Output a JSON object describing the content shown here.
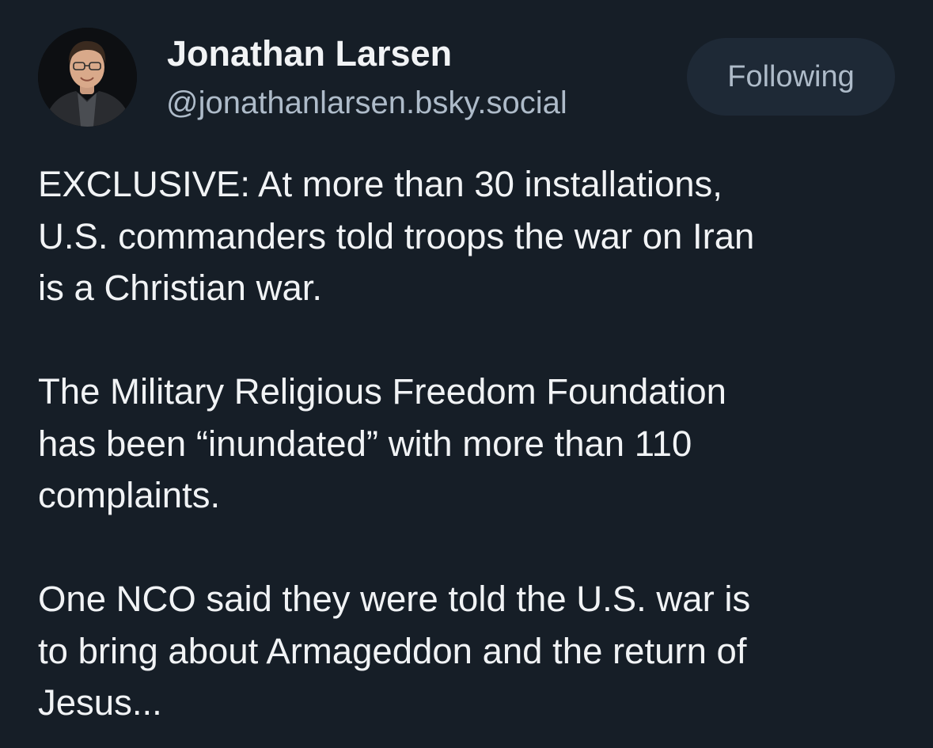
{
  "author": {
    "name": "Jonathan Larsen",
    "handle": "@jonathanlarsen.bsky.social"
  },
  "follow_button": {
    "label": "Following"
  },
  "post": {
    "paragraphs": [
      "EXCLUSIVE: At more than 30 installations,\nU.S. commanders told troops the war on Iran\nis a Christian war.",
      "The Military Religious Freedom Foundation\nhas been “inundated” with more than 110\ncomplaints.",
      "One NCO said they were told the U.S. war is\nto bring about Armageddon and the return of\nJesus..."
    ]
  },
  "colors": {
    "background": "#161e27",
    "text_primary": "#f1f3f5",
    "text_secondary": "#aebbc9",
    "button_background": "#1e2936"
  }
}
